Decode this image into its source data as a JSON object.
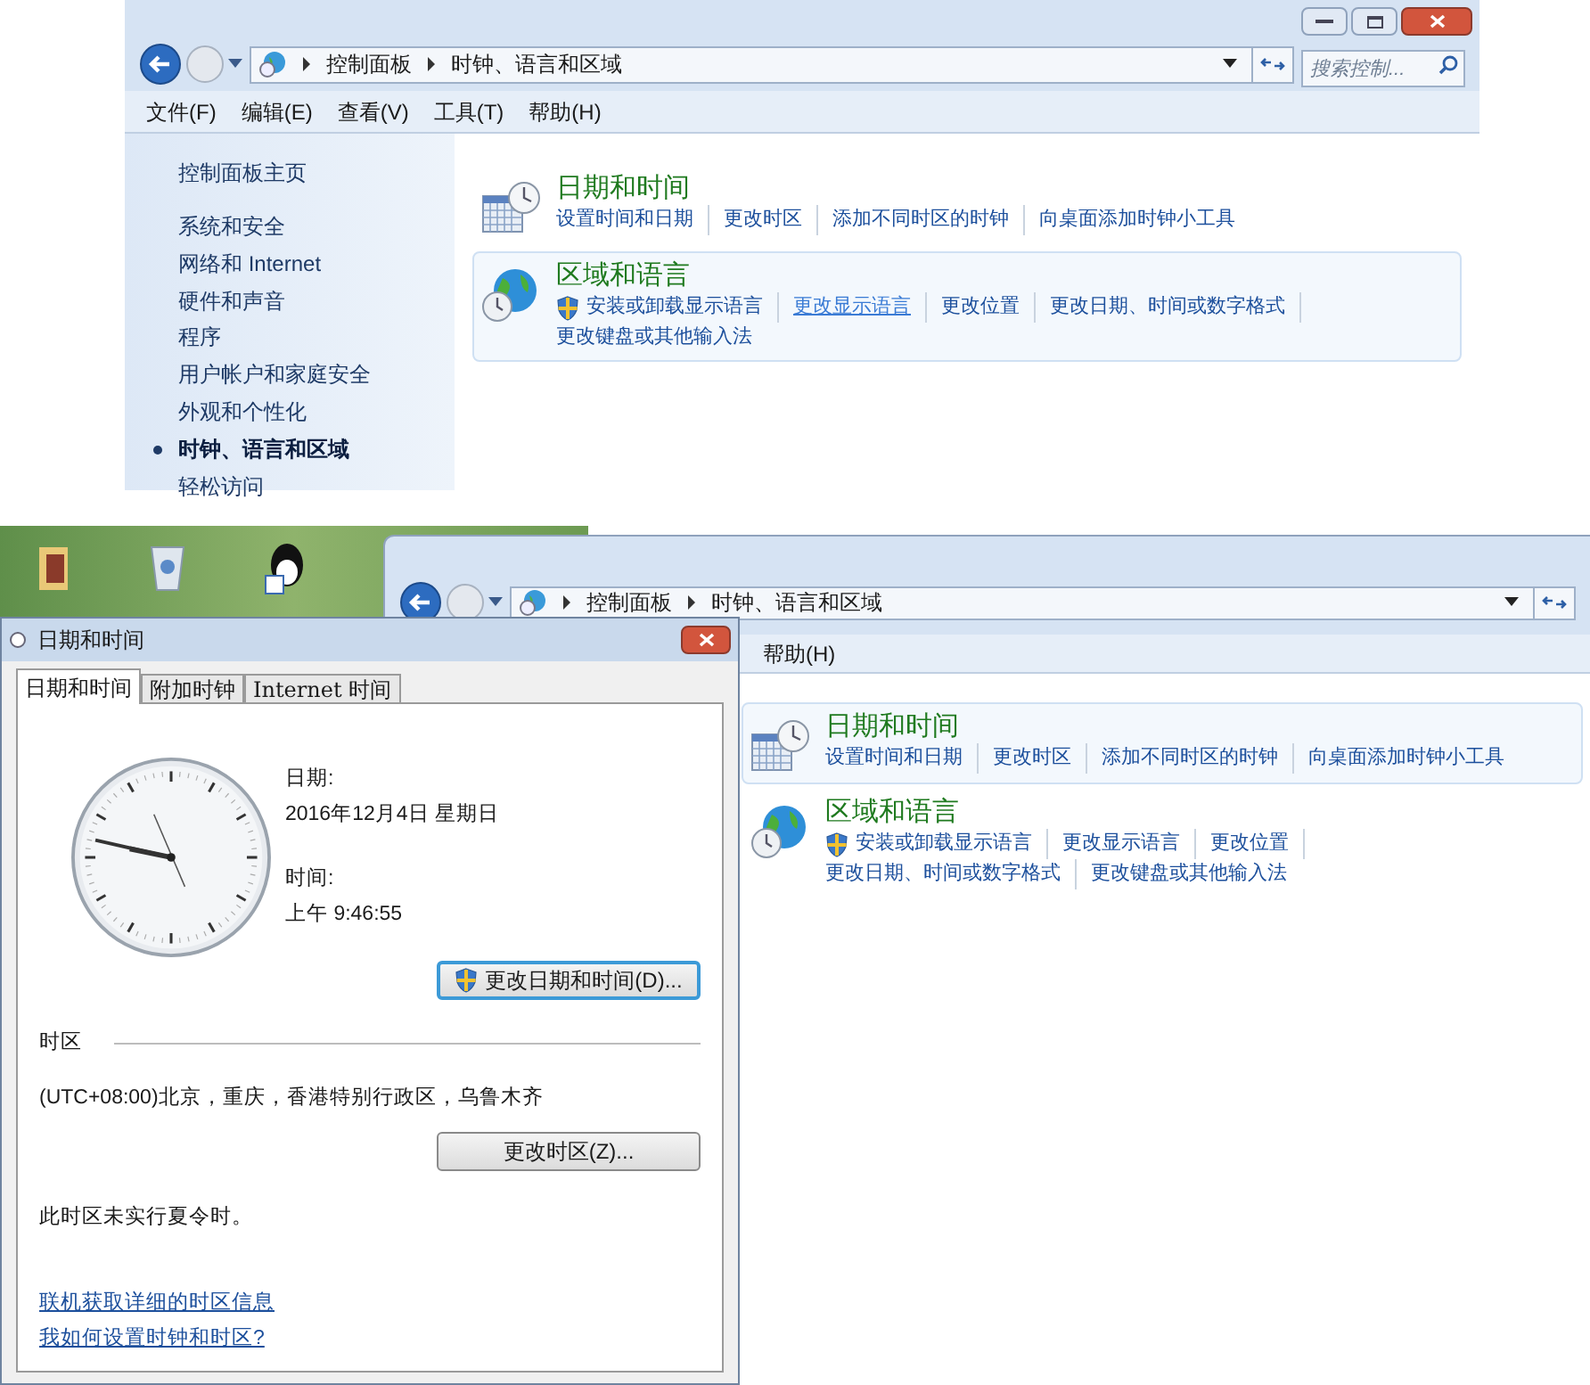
{
  "top_window": {
    "breadcrumbs": [
      "控制面板",
      "时钟、语言和区域"
    ],
    "search": {
      "placeholder": "搜索控制..."
    },
    "menu": [
      "文件(F)",
      "编辑(E)",
      "查看(V)",
      "工具(T)",
      "帮助(H)"
    ],
    "sidebar": {
      "home": "控制面板主页",
      "items": [
        {
          "label": "系统和安全",
          "selected": false
        },
        {
          "label": "网络和 Internet",
          "selected": false
        },
        {
          "label": "硬件和声音",
          "selected": false
        },
        {
          "label": "程序",
          "selected": false
        },
        {
          "label": "用户帐户和家庭安全",
          "selected": false
        },
        {
          "label": "外观和个性化",
          "selected": false
        },
        {
          "label": "时钟、语言和区域",
          "selected": true
        },
        {
          "label": "轻松访问",
          "selected": false
        }
      ]
    },
    "categories": [
      {
        "kind": "datetime",
        "title": "日期和时间",
        "highlighted": false,
        "links": [
          {
            "label": "设置时间和日期",
            "shield": false,
            "hovered": false
          },
          {
            "label": "更改时区",
            "shield": false,
            "hovered": false
          },
          {
            "label": "添加不同时区的时钟",
            "shield": false,
            "hovered": false
          },
          {
            "label": "向桌面添加时钟小工具",
            "shield": false,
            "hovered": false
          }
        ]
      },
      {
        "kind": "region",
        "title": "区域和语言",
        "highlighted": true,
        "links": [
          {
            "label": "安装或卸载显示语言",
            "shield": true,
            "hovered": false
          },
          {
            "label": "更改显示语言",
            "shield": false,
            "hovered": true
          },
          {
            "label": "更改位置",
            "shield": false,
            "hovered": false
          },
          {
            "label": "更改日期、时间或数字格式",
            "shield": false,
            "hovered": false
          },
          {
            "label": "更改键盘或其他输入法",
            "shield": false,
            "hovered": false
          }
        ]
      }
    ]
  },
  "back_window": {
    "breadcrumbs": [
      "控制面板",
      "时钟、语言和区域"
    ],
    "menu": [
      "帮助(H)"
    ],
    "categories": [
      {
        "kind": "datetime",
        "title": "日期和时间",
        "highlighted": true,
        "links": [
          {
            "label": "设置时间和日期",
            "shield": false,
            "hovered": false
          },
          {
            "label": "更改时区",
            "shield": false,
            "hovered": false
          },
          {
            "label": "添加不同时区的时钟",
            "shield": false,
            "hovered": false
          },
          {
            "label": "向桌面添加时钟小工具",
            "shield": false,
            "hovered": false
          }
        ]
      },
      {
        "kind": "region",
        "title": "区域和语言",
        "highlighted": false,
        "links": [
          {
            "label": "安装或卸载显示语言",
            "shield": true,
            "hovered": false
          },
          {
            "label": "更改显示语言",
            "shield": false,
            "hovered": false
          },
          {
            "label": "更改位置",
            "shield": false,
            "hovered": false
          },
          {
            "label": "更改日期、时间或数字格式",
            "shield": false,
            "hovered": false
          },
          {
            "label": "更改键盘或其他输入法",
            "shield": false,
            "hovered": false
          }
        ]
      }
    ]
  },
  "dialog": {
    "title": "日期和时间",
    "tabs": [
      {
        "label": "日期和时间",
        "selected": true
      },
      {
        "label": "附加时钟",
        "selected": false
      },
      {
        "label": "Internet 时间",
        "selected": false
      }
    ],
    "date_label": "日期:",
    "date": "2016年12月4日 星期日",
    "time_label": "时间:",
    "time": "上午 9:46:55",
    "change_datetime_button": {
      "label": "更改日期和时间(D)...",
      "shield": true,
      "focused": true
    },
    "timezone_heading": "时区",
    "timezone": "(UTC+08:00)北京，重庆，香港特别行政区，乌鲁木齐",
    "change_timezone_button": {
      "label": "更改时区(Z)...",
      "shield": false,
      "focused": false
    },
    "dst_note": "此时区未实行夏令时。",
    "links": [
      "联机获取详细的时区信息",
      "我如何设置时钟和时区?"
    ]
  }
}
